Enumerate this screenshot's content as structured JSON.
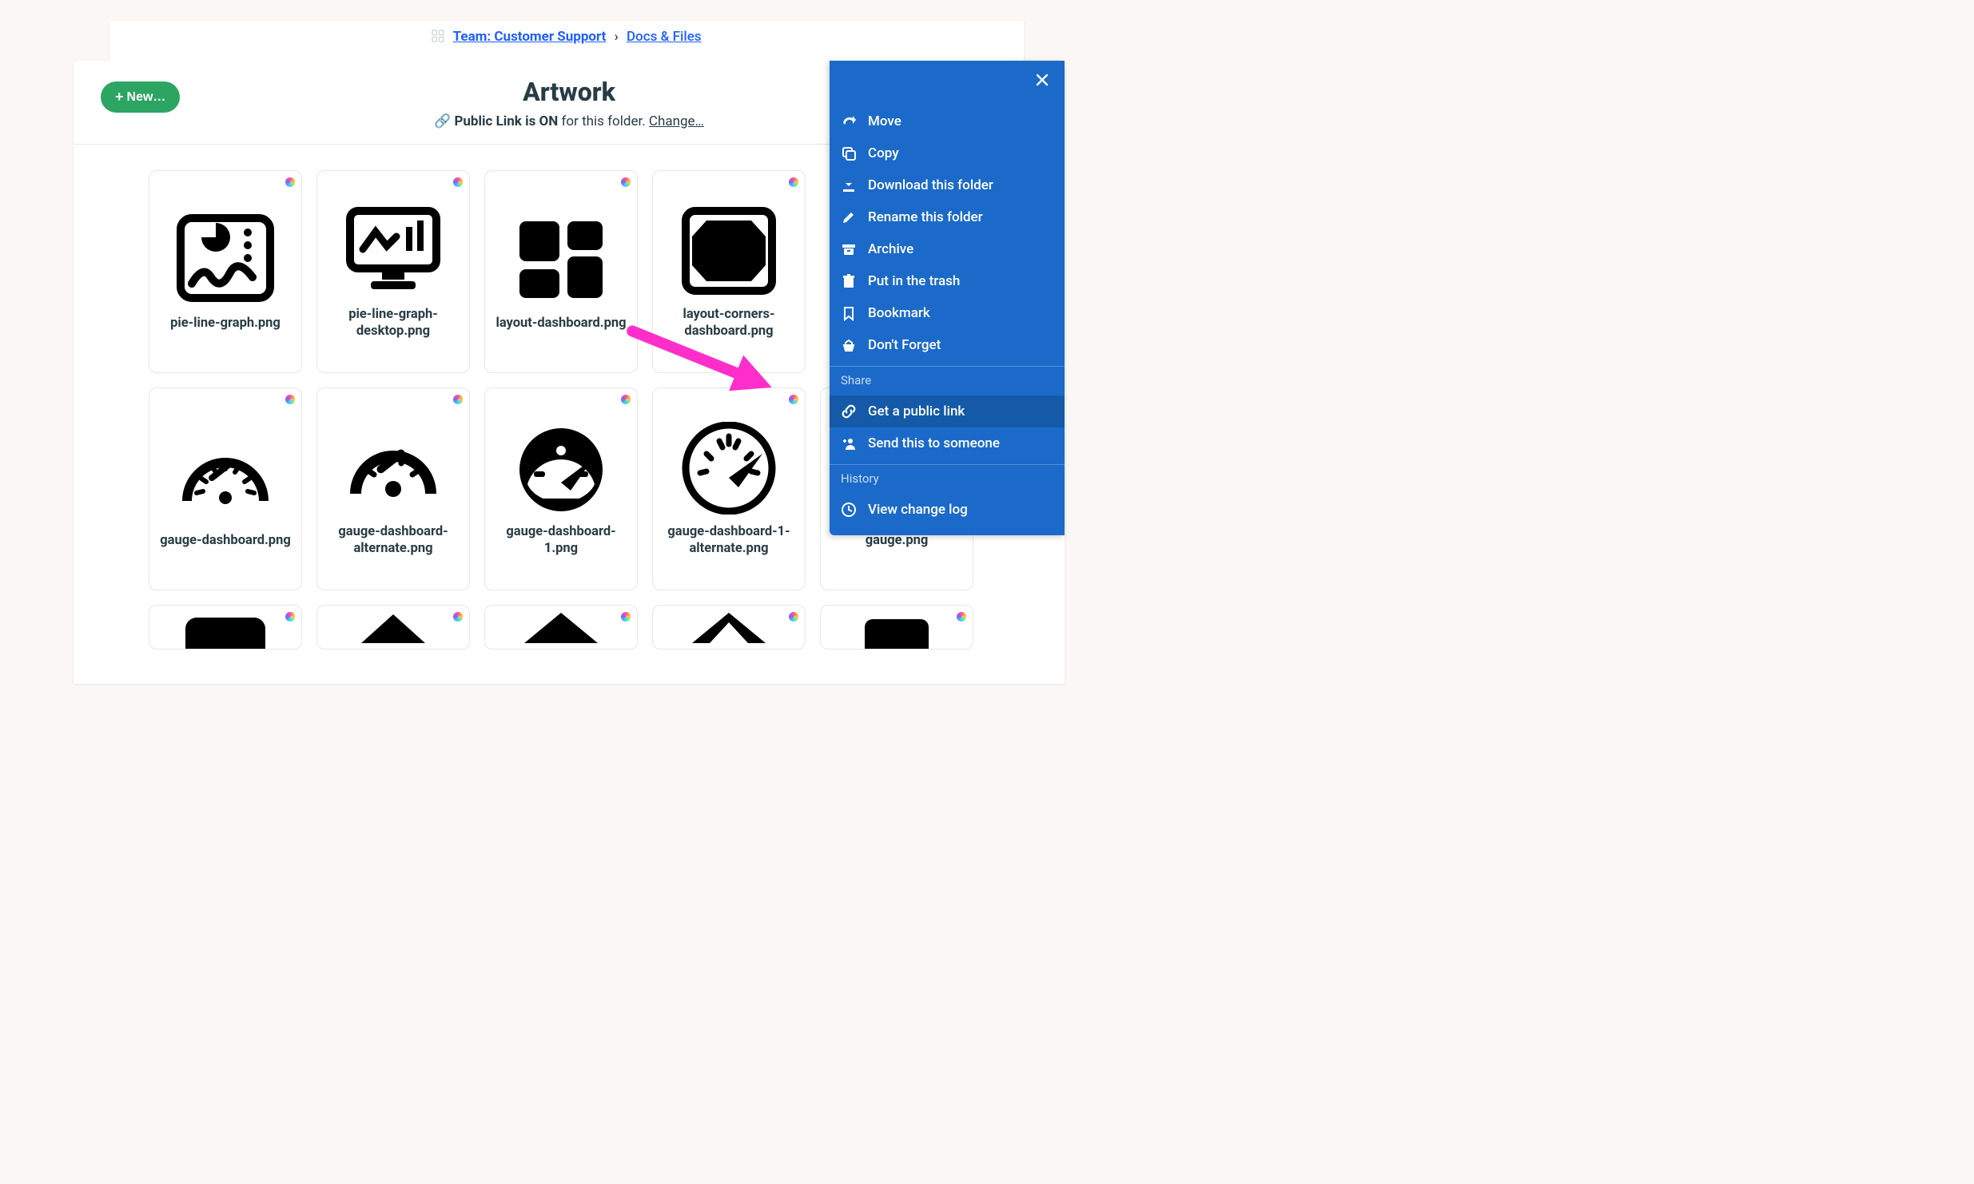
{
  "breadcrumb": {
    "team_label": "Team: Customer Support",
    "section_label": "Docs & Files"
  },
  "header": {
    "new_button": "New…",
    "title": "Artwork",
    "public_bold": "Public Link is ON",
    "public_rest": "for this folder.",
    "public_change": "Change…"
  },
  "files": {
    "r0c0": "pie-line-graph.png",
    "r0c1": "pie-line-graph-desktop.png",
    "r0c2": "layout-dashboard.png",
    "r0c3": "layout-corners-dashboard.png",
    "r1c0": "gauge-dashboard.png",
    "r1c1": "gauge-dashboard-alternate.png",
    "r1c2": "gauge-dashboard-1.png",
    "r1c3": "gauge-dashboard-1-alternate.png",
    "r1c4": "gauge.png"
  },
  "menu": {
    "move": "Move",
    "copy": "Copy",
    "download": "Download this folder",
    "rename": "Rename this folder",
    "archive": "Archive",
    "trash": "Put in the trash",
    "bookmark": "Bookmark",
    "dont_forget": "Don't Forget",
    "share_heading": "Share",
    "public_link": "Get a public link",
    "send": "Send this to someone",
    "history_heading": "History",
    "changelog": "View change log"
  }
}
